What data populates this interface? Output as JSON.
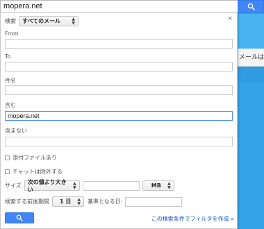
{
  "search": {
    "query": "mopera.net",
    "button_icon": "search-icon"
  },
  "background_app": {
    "partial_text": "メールは臭"
  },
  "panel": {
    "close_label": "×",
    "scope": {
      "label": "検索",
      "selected": "すべてのメール"
    },
    "fields": {
      "from_label": "From",
      "from_value": "",
      "to_label": "To",
      "to_value": "",
      "subject_label": "件名",
      "subject_value": "",
      "has_words_label": "含む",
      "has_words_value": "mopera.net",
      "no_words_label": "含まない",
      "no_words_value": ""
    },
    "checkboxes": {
      "has_attachment_label": "添付ファイルあり",
      "has_attachment_checked": false,
      "exclude_chats_label": "チャットは除外する",
      "exclude_chats_checked": false
    },
    "size": {
      "label": "サイズ",
      "operator_selected": "次の値より大きい",
      "value": "",
      "unit_selected": "MB"
    },
    "date": {
      "label": "検索する前後期間",
      "range_selected": "1 日",
      "base_label": "基準となる日:",
      "base_value": ""
    },
    "search_button_icon": "search-icon",
    "create_filter_link": "この検索条件でフィルタを作成 »"
  },
  "colors": {
    "accent": "#4285f4",
    "link": "#1155cc",
    "focus_border": "#4d90fe",
    "background_app": "#2f9be0"
  }
}
